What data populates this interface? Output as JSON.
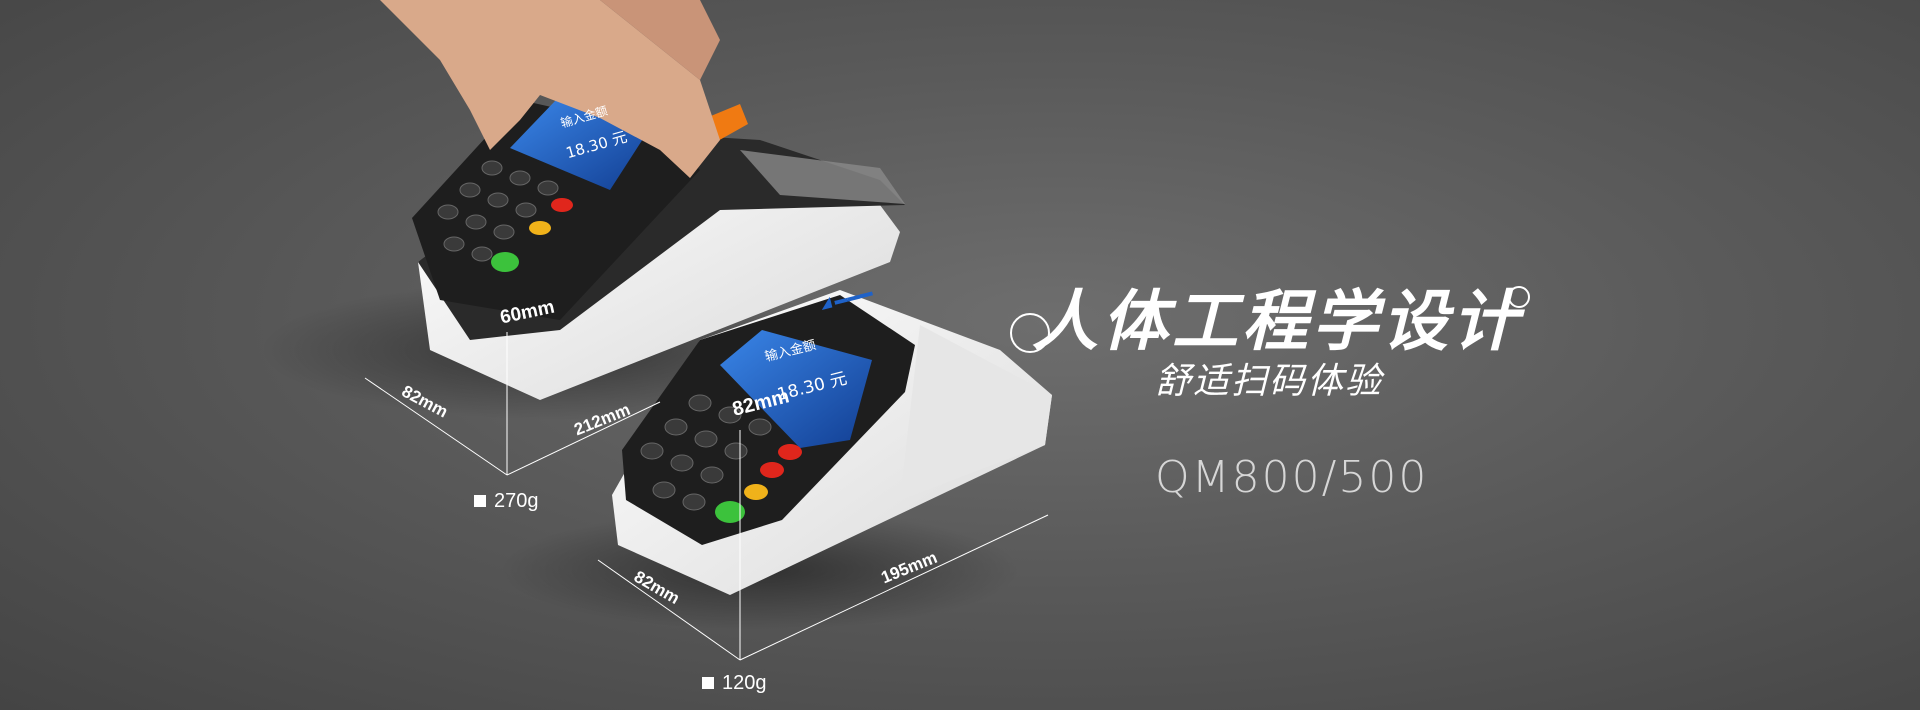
{
  "hero": {
    "headline": "人体工程学设计",
    "subline": "舒适扫码体验",
    "model": "QM800/500"
  },
  "device_large": {
    "height_label": "60mm",
    "depth_label": "82mm",
    "length_label": "212mm",
    "weight_label": "270g",
    "screen_line1": "输入金额",
    "screen_line2": "18.30 元"
  },
  "device_small": {
    "height_label": "82mm",
    "depth_label": "82mm",
    "length_label": "195mm",
    "weight_label": "120g",
    "screen_line1": "输入金额",
    "screen_line2": "18.30 元"
  },
  "colors": {
    "background": "#5a5a5a",
    "device_body": "#f4f4f4",
    "keypad": "#1e1e1e",
    "screen": "#1f62c8",
    "key_green": "#3cc23c",
    "key_red": "#e0261c",
    "key_yellow": "#f0b21a",
    "scanner_orange": "#f07a12"
  }
}
